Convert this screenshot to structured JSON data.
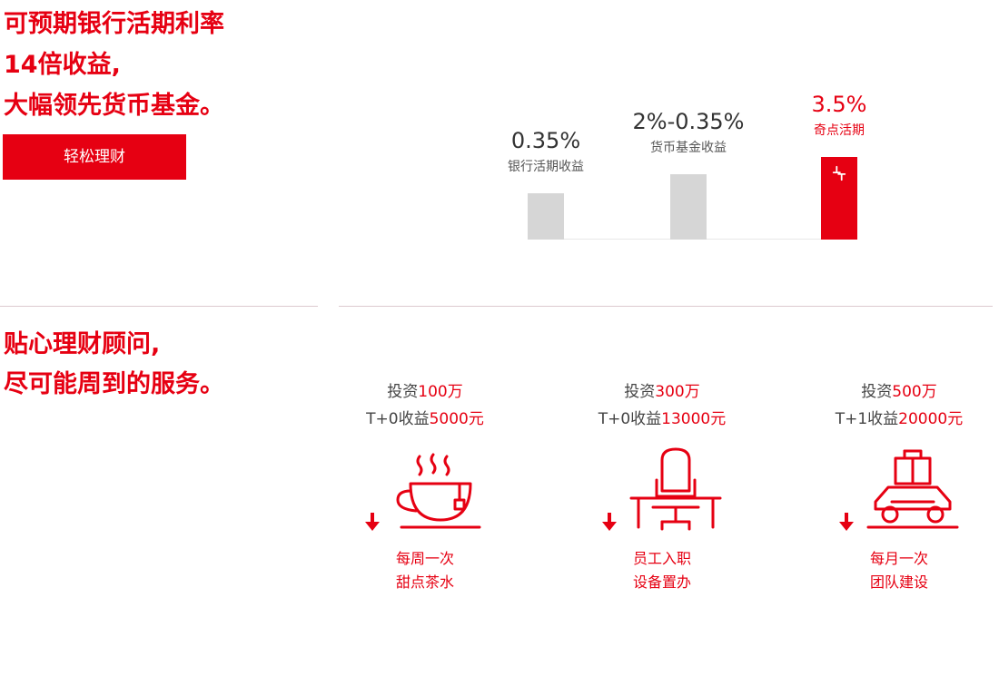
{
  "hero": {
    "title_lines": [
      "可预期银行活期利率",
      "14倍收益,",
      "大幅领先货币基金。"
    ],
    "cta_label": "轻松理财"
  },
  "chart_data": {
    "type": "bar",
    "categories": [
      "银行活期收益",
      "货币基金收益",
      "奇点活期"
    ],
    "value_labels": [
      "0.35%",
      "2%-0.35%",
      "3.5%"
    ],
    "values": [
      0.35,
      0.5,
      0.63
    ],
    "highlight_index": 2,
    "colors": {
      "normal": "#d6d6d6",
      "highlight": "#e60012"
    }
  },
  "service": {
    "title_lines": [
      "贴心理财顾问,",
      "尽可能周到的服务。"
    ],
    "cards": [
      {
        "invest_prefix": "投资",
        "invest_amount": "100万",
        "return_prefix": "T+0收益",
        "return_amount": "5000元",
        "icon": "teacup-icon",
        "caption1": "每周一次",
        "caption2": "甜点茶水"
      },
      {
        "invest_prefix": "投资",
        "invest_amount": "300万",
        "return_prefix": "T+0收益",
        "return_amount": "13000元",
        "icon": "office-chair-desk-icon",
        "caption1": "员工入职",
        "caption2": "设备置办"
      },
      {
        "invest_prefix": "投资",
        "invest_amount": "500万",
        "return_prefix": "T+1收益",
        "return_amount": "20000元",
        "icon": "car-luggage-icon",
        "caption1": "每月一次",
        "caption2": "团队建设"
      }
    ]
  },
  "colors": {
    "accent": "#e60012",
    "divider": "#dcc9ce"
  }
}
